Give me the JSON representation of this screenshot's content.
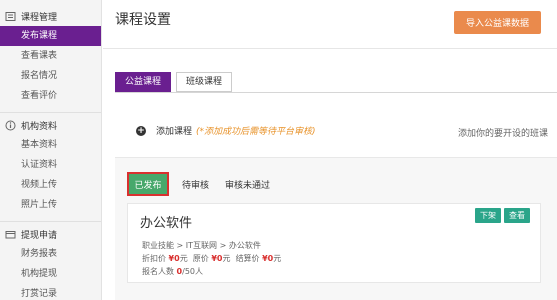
{
  "sidebar": {
    "sections": [
      {
        "title": "课程管理",
        "icon": "course-icon",
        "items": [
          {
            "label": "发布课程",
            "active": true
          },
          {
            "label": "查看课表",
            "active": false
          },
          {
            "label": "报名情况",
            "active": false
          },
          {
            "label": "查看评价",
            "active": false
          }
        ]
      },
      {
        "title": "机构资料",
        "icon": "info-icon",
        "items": [
          {
            "label": "基本资料",
            "active": false
          },
          {
            "label": "认证资料",
            "active": false
          },
          {
            "label": "视频上传",
            "active": false
          },
          {
            "label": "照片上传",
            "active": false
          }
        ]
      },
      {
        "title": "提现申请",
        "icon": "withdraw-icon",
        "items": [
          {
            "label": "财务报表",
            "active": false
          },
          {
            "label": "机构提现",
            "active": false
          },
          {
            "label": "打赏记录",
            "active": false
          }
        ]
      }
    ]
  },
  "header": {
    "title": "课程设置",
    "import_button": "导入公益课数据"
  },
  "tabs": [
    {
      "label": "公益课程",
      "active": true
    },
    {
      "label": "班级课程",
      "active": false
    }
  ],
  "add_course": {
    "label": "添加课程",
    "note": "(*添加成功后需等待平台审核)",
    "hint": "添加你的要开设的班课"
  },
  "status_tabs": [
    {
      "label": "已发布",
      "active": true
    },
    {
      "label": "待审核",
      "active": false
    },
    {
      "label": "审核未通过",
      "active": false
    }
  ],
  "course": {
    "name": "办公软件",
    "breadcrumb": "职业技能 > IT互联网 > 办公软件",
    "discount_label": "折扣价",
    "discount_value": "¥0",
    "discount_unit": "元",
    "original_label": "原价",
    "original_value": "¥0",
    "original_unit": "元",
    "settle_label": "结算价",
    "settle_value": "¥0",
    "settle_unit": "元",
    "enroll_label": "报名人数",
    "enroll_value": "0",
    "enroll_total": "/50人",
    "unpublish_button": "下架",
    "view_button": "查看"
  },
  "colors": {
    "accent": "#6a1f90",
    "import_button": "#ea8a4c",
    "published_tab": "#47a86b",
    "action_button": "#2aa58a",
    "price": "#d9302f",
    "note": "#e8942d"
  }
}
